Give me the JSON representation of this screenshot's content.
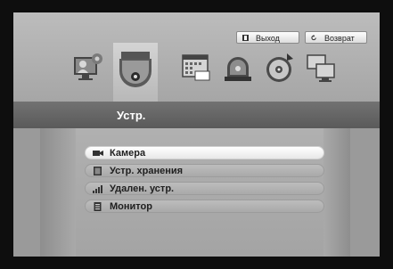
{
  "top_buttons": {
    "exit_label": "Выход",
    "back_label": "Возврат"
  },
  "toolbar": {
    "icons": [
      {
        "name": "display-settings-icon",
        "selected": false
      },
      {
        "name": "dome-camera-icon",
        "selected": true
      },
      {
        "name": "record-schedule-icon",
        "selected": false
      },
      {
        "name": "alarm-event-icon",
        "selected": false
      },
      {
        "name": "backup-disc-icon",
        "selected": false
      },
      {
        "name": "network-icon",
        "selected": false
      }
    ]
  },
  "section": {
    "title": "Устр."
  },
  "menu": {
    "items": [
      {
        "label": "Камера",
        "icon": "camera-icon",
        "active": true
      },
      {
        "label": "Устр. хранения",
        "icon": "storage-icon",
        "active": false
      },
      {
        "label": "Удален. устр.",
        "icon": "remote-device-icon",
        "active": false
      },
      {
        "label": "Монитор",
        "icon": "monitor-icon",
        "active": false
      }
    ]
  },
  "colors": {
    "frame": "#0e0e0e",
    "panel": "#b3b3b3",
    "titlebar": "#656565",
    "accent_ring": "#222222"
  }
}
